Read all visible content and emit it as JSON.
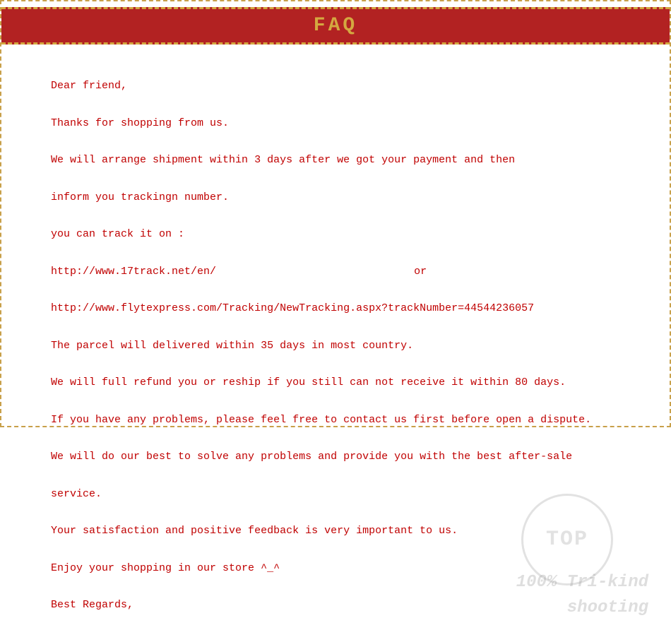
{
  "page": {
    "title": "FAQ",
    "header": {
      "label": "FAQ"
    },
    "content": {
      "line1": "Dear friend,",
      "line2": "Thanks for shopping from us.",
      "line3": "We will arrange shipment within 3 days after we got your payment and then",
      "line4": "inform you trackingn number.",
      "line5": "you can track it on :",
      "line6a": "http://www.17track.net/en/",
      "line6b": "or",
      "line7": "http://www.flytexpress.com/Tracking/NewTracking.aspx?trackNumber=44544236057",
      "line8": "The parcel will delivered within 35 days in most country.",
      "line9": "We will full refund you or reship if you still can not receive it within 80 days.",
      "line10": "If you have any problems, please feel free to contact us first before open a dispute.",
      "line11": "We will do our best to solve any problems and provide you with the best after-sale",
      "line12": "service.",
      "line13": "Your satisfaction and positive feedback is very important to us.",
      "line14": "Enjoy your shopping in our store ^_^",
      "line15": "Best Regards,"
    },
    "watermark": {
      "circle_text": "TOP",
      "line1": "100% Tri-kind",
      "line2": "shooting"
    }
  }
}
